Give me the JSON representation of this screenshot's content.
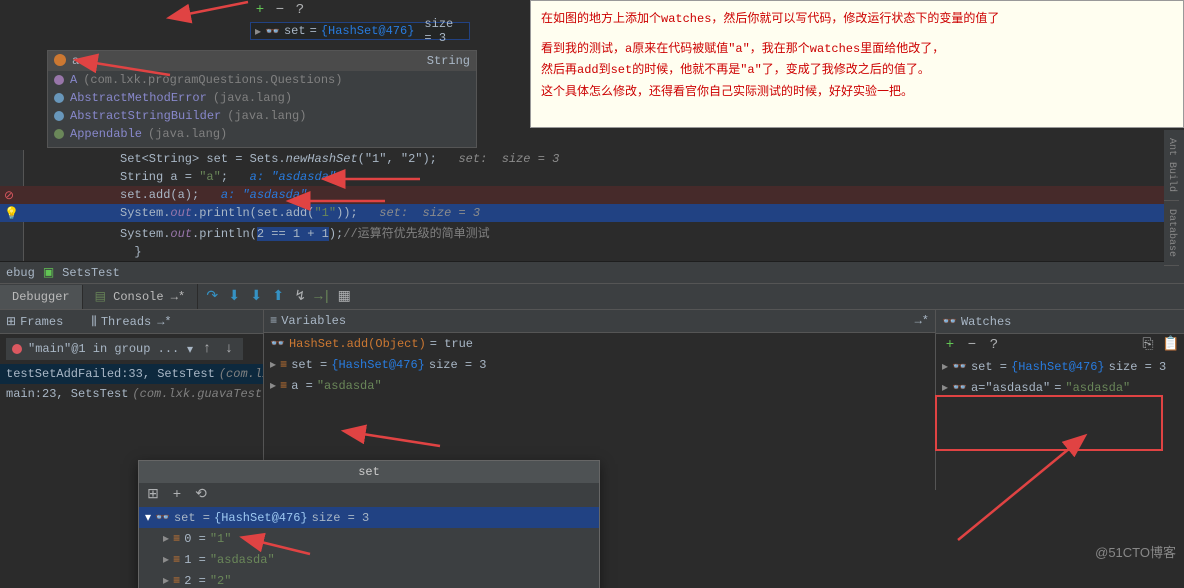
{
  "popup": {
    "var": "a",
    "type": "String",
    "rows": [
      {
        "cls": "A",
        "pkg": "(com.lxk.programQuestions.Questions)",
        "color": "#9876aa"
      },
      {
        "cls": "AbstractMethodError",
        "pkg": "(java.lang)",
        "color": "#6897bb"
      },
      {
        "cls": "AbstractStringBuilder",
        "pkg": "(java.lang)",
        "color": "#6897bb"
      },
      {
        "cls": "Appendable",
        "pkg": "(java.lang)",
        "color": "#6a8759"
      }
    ]
  },
  "top_set": {
    "name": "set",
    "value": "{HashSet@476}",
    "extra": "size = 3"
  },
  "comment": {
    "l1": "在如图的地方上添加个watches，然后你就可以写代码，修改运行状态下的变量的值了",
    "l2": "看到我的测试，a原来在代码被赋值\"a\"，我在那个watches里面给他改了，",
    "l3": "然后再add到set的时候，他就不再是\"a\"了，变成了我修改之后的值了。",
    "l4": "这个具体怎么修改，还得看官你自己实际测试的时候，好好实验一把。"
  },
  "code": {
    "l1_pre": "Set<String> set = Sets.",
    "l1_fn": "newHashSet",
    "l1_args": "(\"1\", \"2\");",
    "l1_hint": "set:  size = 3",
    "l2_pre": "String a = ",
    "l2_val": "\"a\"",
    "l2_semi": ";",
    "l2_hint": "a: \"asdasda\"",
    "l3_pre": "set.add(a);",
    "l3_hint": "a: \"asdasda\"",
    "l4_pre": "System.",
    "l4_out": "out",
    "l4_mid": ".println(set.add(",
    "l4_arg": "\"1\"",
    "l4_end": "));",
    "l4_hint": "set:  size = 3",
    "l5_pre": "System.",
    "l5_out": "out",
    "l5_mid": ".println(",
    "l5_arg": "2 == 1 + 1",
    "l5_end": ");",
    "l5_comm": "//运算符优先级的简单测试"
  },
  "debug_header": {
    "label": "ebug",
    "tab": "SetsTest"
  },
  "tabs": {
    "debugger": "Debugger",
    "console": "Console"
  },
  "frames": {
    "header": "Frames",
    "threads_header": "Threads",
    "thread": "\"main\"@1 in group ...",
    "f1": "testSetAddFailed:33, SetsTest",
    "f1_pkg": "(com.lxk.gu...",
    "f2": "main:23, SetsTest",
    "f2_pkg": "(com.lxk.guavaTest)"
  },
  "vars": {
    "header": "Variables",
    "v1_label": "HashSet.add(Object)",
    "v1_eq": " = true",
    "v2_label": "set = ",
    "v2_val": "{HashSet@476}",
    "v2_extra": "  size = 3",
    "v3_label": "a = ",
    "v3_val": "\"asdasda\""
  },
  "watches": {
    "header": "Watches",
    "w1_label": "set = ",
    "w1_val": "{HashSet@476}",
    "w1_extra": "  size = 3",
    "w2_label": "a=\"asdasda\"",
    "w2_eq": " = ",
    "w2_val": "\"asdasda\""
  },
  "hover": {
    "title": "set",
    "h1": "set = ",
    "h1v": "{HashSet@476}",
    "h1e": "  size = 3",
    "r0": "0 = ",
    "r0v": "\"1\"",
    "r1": "1 = ",
    "r1v": "\"asdasda\"",
    "r2": "2 = ",
    "r2v": "\"2\""
  },
  "side": {
    "ant": "Ant Build",
    "db": "Database"
  },
  "watermark": "@51CTO博客"
}
